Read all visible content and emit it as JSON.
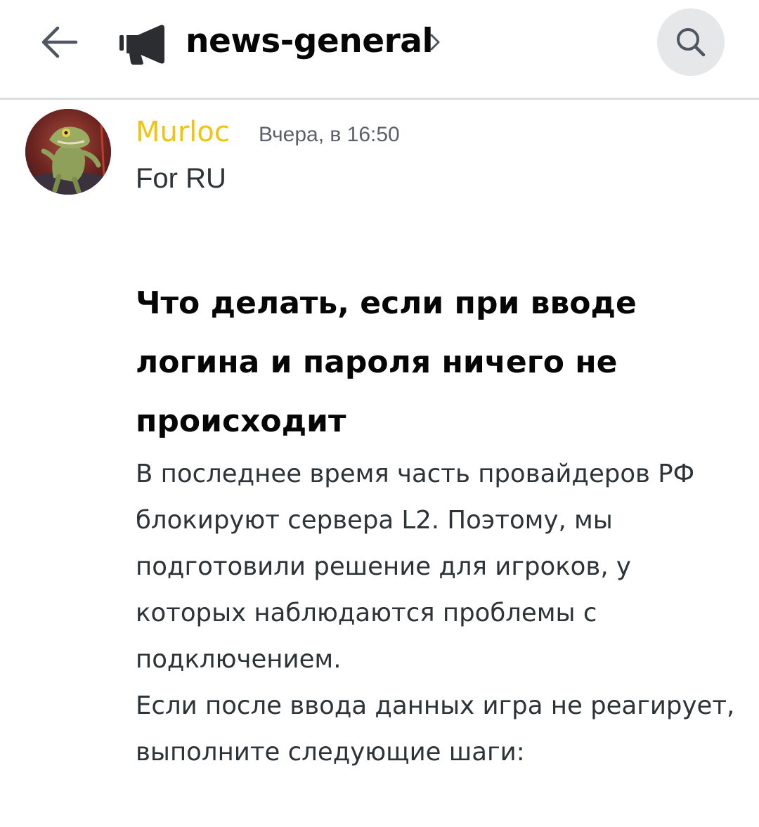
{
  "header": {
    "back_icon": "arrow-left-icon",
    "channel_icon": "megaphone-icon",
    "channel_name": "news-general",
    "chevron_icon": "chevron-right-icon",
    "search_icon": "search-icon"
  },
  "colors": {
    "author": "#f1c40f",
    "heading": "#060607",
    "text": "#2e3338",
    "timestamp": "#5c6069",
    "search_bg": "#e6e7e9"
  },
  "message": {
    "author": "Murloc",
    "timestamp": "Вчера, в 16:50",
    "first_line": "For RU",
    "heading": "Что делать, если при вводе логина и пароля ничего не происходит",
    "paragraphs": [
      "В последнее время часть провайдеров РФ блокируют сервера L2. Поэтому, мы подготовили решение для игроков, у которых наблюдаются проблемы с подключением.",
      "Если после ввода данных игра не реагирует, выполните следующие шаги:"
    ]
  }
}
